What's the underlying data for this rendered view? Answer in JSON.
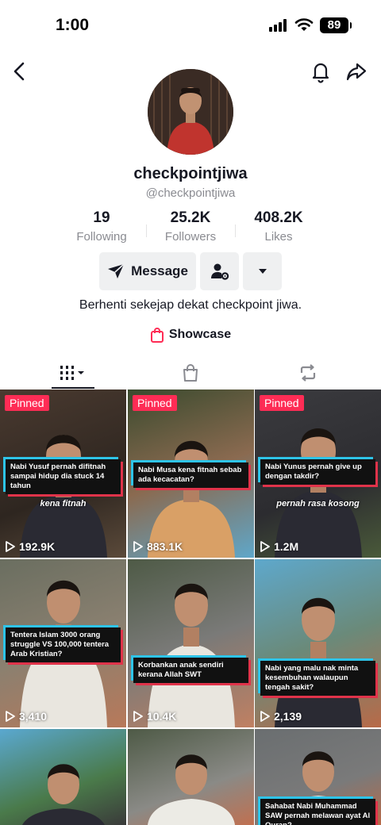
{
  "status_bar": {
    "time": "1:00",
    "battery": "89"
  },
  "profile": {
    "username": "checkpointjiwa",
    "handle": "@checkpointjiwa",
    "stats": [
      {
        "value": "19",
        "label": "Following"
      },
      {
        "value": "25.2K",
        "label": "Followers"
      },
      {
        "value": "408.2K",
        "label": "Likes"
      }
    ],
    "message_label": "Message",
    "bio": "Berhenti sekejap dekat checkpoint jiwa.",
    "showcase_label": "Showcase"
  },
  "icons": {
    "back": "chevron-left-icon",
    "bell": "bell-icon",
    "share": "share-icon",
    "message": "send-icon",
    "add_friend": "person-gear-icon",
    "more": "caret-down-icon",
    "showcase": "shopping-bag-icon",
    "tab_videos": "grid-icon",
    "tab_shop": "bag-icon",
    "tab_reposts": "repost-icon",
    "views": "play-icon"
  },
  "colors": {
    "pinned": "#fe2c55",
    "caption_cyan": "#2ec4e8",
    "caption_red": "#e0334a"
  },
  "videos": [
    {
      "pinned": "Pinned",
      "caption": "Nabi Yusuf pernah difitnah sampai hidup dia stuck 14 tahun",
      "subtext": "kena fitnah",
      "views": "192.9K"
    },
    {
      "pinned": "Pinned",
      "caption": "Nabi Musa kena fitnah sebab ada kecacatan?",
      "subtext": "",
      "views": "883.1K"
    },
    {
      "pinned": "Pinned",
      "caption": "Nabi Yunus pernah give up dengan takdir?",
      "subtext": "pernah rasa kosong",
      "views": "1.2M"
    },
    {
      "pinned": "",
      "caption": "Tentera Islam 3000 orang struggle VS 100,000 tentera Arab Kristian?",
      "subtext": "",
      "views": "3,410"
    },
    {
      "pinned": "",
      "caption": "Korbankan anak sendiri kerana Allah SWT",
      "subtext": "",
      "views": "10.4K"
    },
    {
      "pinned": "",
      "caption": "Nabi yang malu nak minta kesembuhan walaupun tengah sakit?",
      "subtext": "",
      "views": "2,139"
    },
    {
      "pinned": "",
      "caption": "",
      "subtext": "",
      "views": ""
    },
    {
      "pinned": "",
      "caption": "",
      "subtext": "",
      "views": ""
    },
    {
      "pinned": "",
      "caption": "Sahabat Nabi Muhammad SAW pernah melawan ayat Al Quran?",
      "subtext": "",
      "views": ""
    }
  ]
}
